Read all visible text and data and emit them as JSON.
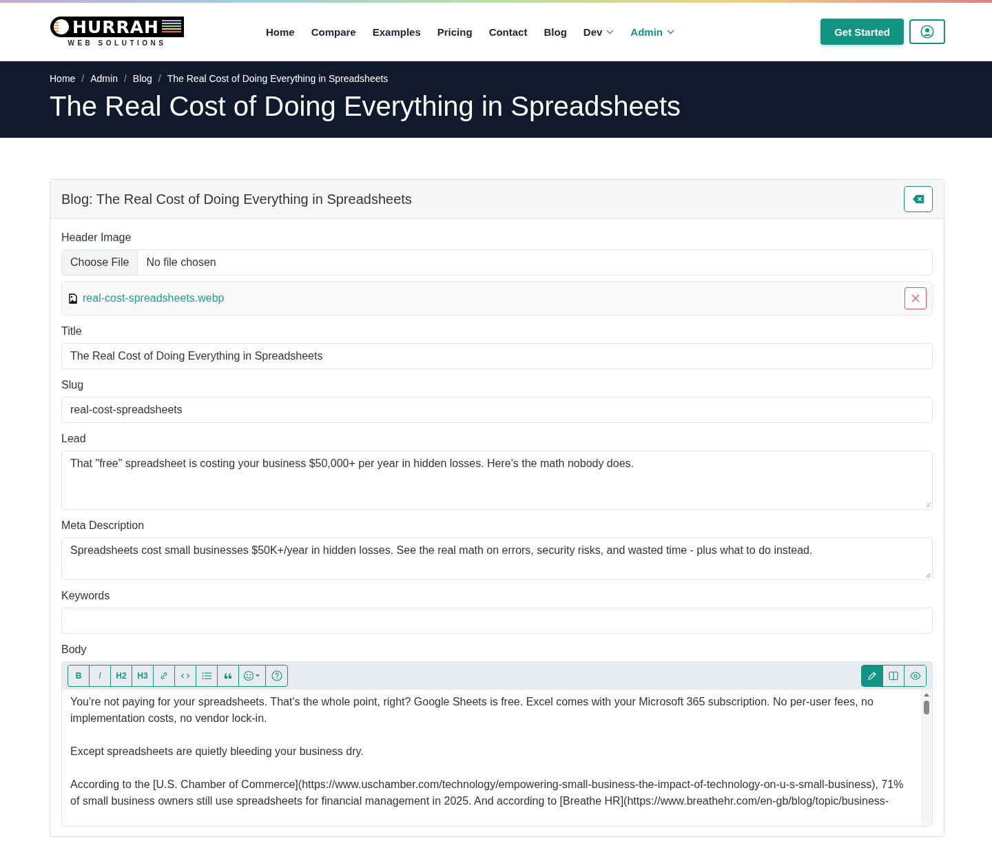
{
  "logo": {
    "name": "HURRAH",
    "tagline": "WEB SOLUTIONS"
  },
  "nav": [
    {
      "label": "Home",
      "selected": false,
      "dropdown": false
    },
    {
      "label": "Compare",
      "selected": false,
      "dropdown": false
    },
    {
      "label": "Examples",
      "selected": false,
      "dropdown": false
    },
    {
      "label": "Pricing",
      "selected": false,
      "dropdown": false
    },
    {
      "label": "Contact",
      "selected": false,
      "dropdown": false
    },
    {
      "label": "Blog",
      "selected": false,
      "dropdown": false
    },
    {
      "label": "Dev",
      "selected": false,
      "dropdown": true
    },
    {
      "label": "Admin",
      "selected": true,
      "dropdown": true
    }
  ],
  "cta": "Get Started",
  "breadcrumb": [
    {
      "kind": "link",
      "text": "Home"
    },
    {
      "kind": "separator",
      "text": "/"
    },
    {
      "kind": "link",
      "text": "Admin"
    },
    {
      "kind": "separator",
      "text": "/"
    },
    {
      "kind": "link",
      "text": "Blog"
    },
    {
      "kind": "separator",
      "text": "/"
    },
    {
      "kind": "current",
      "text": "The Real Cost of Doing Everything in Spreadsheets"
    }
  ],
  "page_title": "The Real Cost of Doing Everything in Spreadsheets",
  "card": {
    "title": "Blog: The Real Cost of Doing Everything in Spreadsheets",
    "header_image": {
      "label": "Header Image",
      "button": "Choose File",
      "status": "No file chosen",
      "current_file": "real-cost-spreadsheets.webp"
    },
    "fields": [
      {
        "label": "Title",
        "kind": "input",
        "value": "The Real Cost of Doing Everything in Spreadsheets"
      },
      {
        "label": "Slug",
        "kind": "input",
        "value": "real-cost-spreadsheets"
      },
      {
        "label": "Lead",
        "kind": "textarea",
        "value": "That \"free\" spreadsheet is costing your business $50,000+ per year in hidden losses. Here's the math nobody does."
      },
      {
        "label": "Meta Description",
        "kind": "textarea-short",
        "value": "Spreadsheets cost small businesses $50K+/year in hidden losses. See the real math on errors, security risks, and wasted time - plus what to do instead."
      },
      {
        "label": "Keywords",
        "kind": "input"
      }
    ],
    "body": {
      "label": "Body",
      "toolbar": [
        {
          "label": "B"
        },
        {
          "label": "I"
        },
        {
          "label": "H2"
        },
        {
          "label": "H3"
        }
      ],
      "view_modes": [
        {
          "selected": true
        },
        {
          "selected": false
        },
        {
          "selected": false
        }
      ],
      "paragraphs": [
        "You're not paying for your spreadsheets. That's the whole point, right? Google Sheets is free. Excel comes with your Microsoft 365 subscription. No per-user fees, no implementation costs, no vendor lock-in.",
        "Except spreadsheets are quietly bleeding your business dry.",
        "According to the [U.S. Chamber of Commerce](https://www.uschamber.com/technology/empowering-small-business-the-impact-of-technology-on-u-s-small-business), 71% of small business owners still use spreadsheets for financial management in 2025. And according to [Breathe HR](https://www.breathehr.com/en-gb/blog/topic/business-"
      ]
    }
  }
}
